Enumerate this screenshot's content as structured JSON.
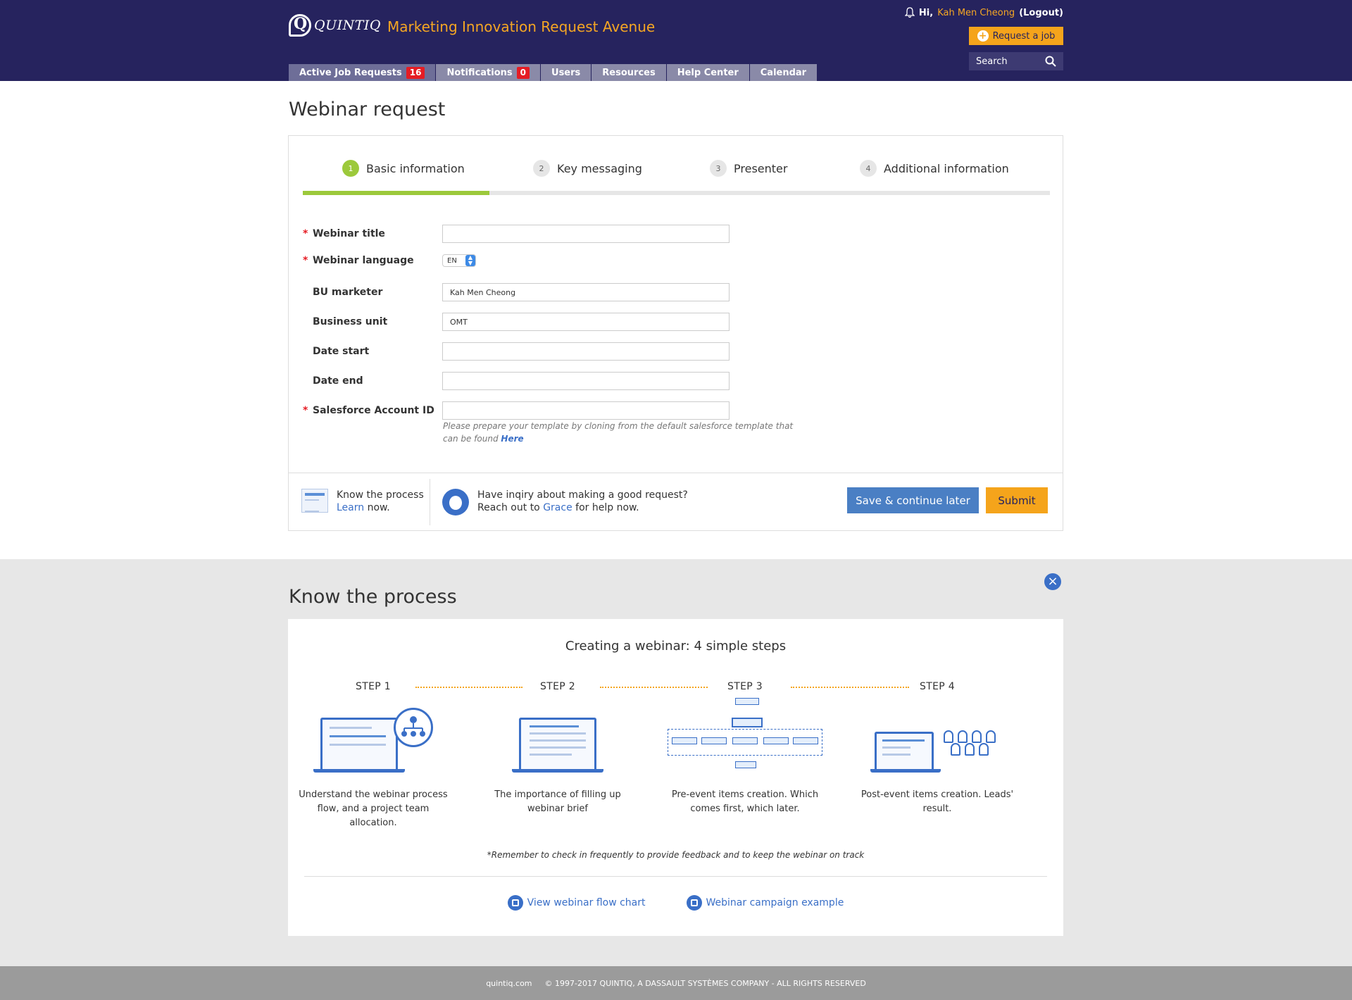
{
  "header": {
    "logo_text": "QUINTIQ",
    "app_title": "Marketing Innovation Request Avenue",
    "greeting": "Hi,",
    "user_name": "Kah Men Cheong",
    "logout": "(Logout)",
    "request_button": "Request a job",
    "search_placeholder": "Search",
    "nav": [
      {
        "label": "Active Job Requests",
        "badge": "16"
      },
      {
        "label": "Notifications",
        "badge": "0"
      },
      {
        "label": "Users"
      },
      {
        "label": "Resources"
      },
      {
        "label": "Help Center"
      },
      {
        "label": "Calendar"
      }
    ]
  },
  "page": {
    "title": "Webinar request",
    "steps": [
      {
        "num": "1",
        "label": "Basic information",
        "active": true
      },
      {
        "num": "2",
        "label": "Key messaging"
      },
      {
        "num": "3",
        "label": "Presenter"
      },
      {
        "num": "4",
        "label": "Additional information"
      }
    ],
    "progress": 0.25,
    "fields": {
      "webinar_title": {
        "label": "Webinar title",
        "required": true,
        "value": ""
      },
      "webinar_language": {
        "label": "Webinar language",
        "required": true,
        "value": "EN"
      },
      "bu_marketer": {
        "label": "BU marketer",
        "value": "Kah Men Cheong"
      },
      "business_unit": {
        "label": "Business unit",
        "value": "OMT"
      },
      "date_start": {
        "label": "Date start",
        "value": ""
      },
      "date_end": {
        "label": "Date end",
        "value": ""
      },
      "salesforce_id": {
        "label": "Salesforce Account ID",
        "required": true,
        "value": ""
      }
    },
    "required_mark": "*",
    "help_text": "Please prepare your template by cloning from the default salesforce template that can be found",
    "help_link": "Here",
    "footer": {
      "know_line1": "Know the process",
      "know_link": "Learn",
      "know_after": "now.",
      "inquiry_line1": "Have inqiry about making a good request?",
      "inquiry_before": "Reach out to",
      "inquiry_link": "Grace",
      "inquiry_after": "for help now.",
      "save_button": "Save & continue later",
      "submit_button": "Submit"
    }
  },
  "process": {
    "title": "Know the process",
    "subtitle": "Creating a webinar: 4 simple steps",
    "steps": [
      {
        "label": "STEP 1",
        "desc": "Understand the webinar process flow, and a project team allocation."
      },
      {
        "label": "STEP 2",
        "desc": "The importance of filling up webinar brief"
      },
      {
        "label": "STEP 3",
        "desc": "Pre-event items creation. Which comes first, which later."
      },
      {
        "label": "STEP 4",
        "desc": "Post-event items creation. Leads' result."
      }
    ],
    "note": "*Remember to check in frequently to provide feedback and to keep the webinar on track",
    "links": [
      "View webinar flow chart",
      "Webinar campaign example"
    ]
  },
  "footer": {
    "site": "quintiq.com",
    "copyright": "© 1997-2017 QUINTIQ, A DASSAULT SYSTÈMES COMPANY - ALL RIGHTS RESERVED"
  },
  "colors": {
    "header_bg": "#26235e",
    "accent_orange": "#f5a41b",
    "step_green": "#9cc93b",
    "link_blue": "#3a6fc7"
  }
}
